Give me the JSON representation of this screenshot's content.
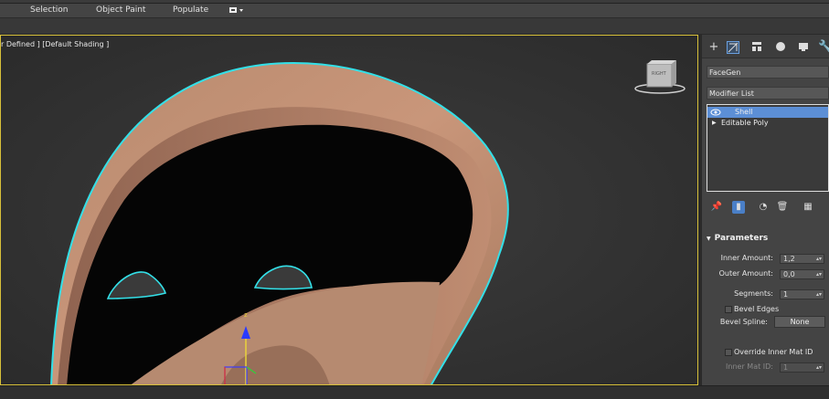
{
  "ribbon": {
    "tabs": [
      "Selection",
      "Object Paint",
      "Populate"
    ]
  },
  "viewport": {
    "label": "r Defined ] [Default Shading ]",
    "viewcube_label": "RIGHT",
    "gizmo_z_label": "z"
  },
  "panel": {
    "object_name": "FaceGen",
    "modifier_list_label": "Modifier List",
    "stack_items": [
      "Shell",
      "Editable Poly"
    ],
    "params_title": "Parameters",
    "inner_amount_label": "Inner Amount:",
    "inner_amount_value": "1,2",
    "outer_amount_label": "Outer Amount:",
    "outer_amount_value": "0,0",
    "segments_label": "Segments:",
    "segments_value": "1",
    "bevel_edges_label": "Bevel Edges",
    "bevel_spline_label": "Bevel Spline:",
    "bevel_spline_value": "None",
    "override_label": "Override Inner Mat ID",
    "inner_mat_label": "Inner Mat ID:",
    "inner_mat_value": "1"
  },
  "colors": {
    "selection_outline": "#33e0e8",
    "skin": "#c9967a",
    "viewport_border": "#d8c13a",
    "selected_row": "#5c8fd6"
  }
}
